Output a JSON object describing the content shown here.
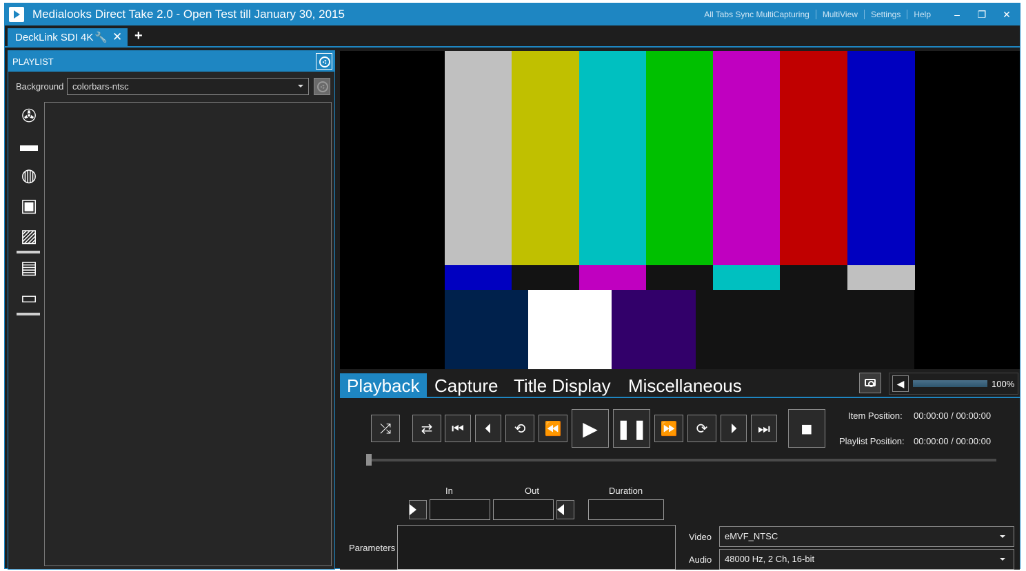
{
  "window": {
    "title": "Medialooks Direct Take 2.0 - Open Test till January 30, 2015",
    "menu": [
      "All Tabs Sync MultiCapturing",
      "MultiView",
      "Settings",
      "Help"
    ],
    "controls": {
      "minimize": "–",
      "maximize": "❐",
      "close": "✕"
    }
  },
  "tabbar": {
    "device_tab": "DeckLink SDI 4K",
    "pin_icon": "🔧",
    "close_glyph": "✕",
    "add_glyph": "+"
  },
  "playlist": {
    "title": "PLAYLIST",
    "background_label": "Background",
    "background_value": "colorbars-ntsc",
    "tools": [
      {
        "icon": "film-reel-icon",
        "glyph": "✇"
      },
      {
        "icon": "video-camera-icon",
        "glyph": "▬"
      },
      {
        "icon": "globe-icon",
        "glyph": "◍"
      },
      {
        "icon": "media-file-icon",
        "glyph": "▣"
      },
      {
        "icon": "image-icon",
        "glyph": "▨"
      },
      {
        "icon": "save-icon",
        "glyph": "▤"
      },
      {
        "icon": "open-folder-icon",
        "glyph": "▭"
      }
    ]
  },
  "preview": {
    "colors": {
      "gray": "#c0c0c0",
      "yellow": "#c0c000",
      "cyan": "#00c0c0",
      "green": "#00c000",
      "magenta": "#c000c0",
      "red": "#c00000",
      "blue": "#0000c0",
      "navy": "#00214c",
      "white": "#ffffff",
      "purple": "#32006a",
      "black": "#131313"
    }
  },
  "mainTabs": [
    "Playback",
    "Capture",
    "Title Display",
    "Miscellaneous"
  ],
  "volume": {
    "percent": "100%",
    "level": 1.0
  },
  "transport": [
    {
      "name": "shuffle-button",
      "glyph": "⤮"
    },
    {
      "name": "loop-button",
      "glyph": "⇄"
    },
    {
      "name": "first-button",
      "glyph": "⏮"
    },
    {
      "name": "prev-button",
      "glyph": "⏴"
    },
    {
      "name": "step-back-button",
      "glyph": "⟲"
    },
    {
      "name": "rewind-button",
      "glyph": "⏪"
    },
    {
      "name": "play-button",
      "glyph": "▶"
    },
    {
      "name": "pause-button",
      "glyph": "❚❚"
    },
    {
      "name": "forward-button",
      "glyph": "⏩"
    },
    {
      "name": "step-forward-button",
      "glyph": "⟳"
    },
    {
      "name": "next-button",
      "glyph": "⏵"
    },
    {
      "name": "last-button",
      "glyph": "⏭"
    },
    {
      "name": "stop-button",
      "glyph": "■"
    }
  ],
  "positions": {
    "item_label": "Item Position:",
    "item_value": "00:00:00 / 00:00:00",
    "playlist_label": "Playlist Position:",
    "playlist_value": "00:00:00 / 00:00:00"
  },
  "trim": {
    "in_label": "In",
    "out_label": "Out",
    "duration_label": "Duration"
  },
  "params": {
    "label": "Parameters",
    "video_label": "Video",
    "video_value": "eMVF_NTSC",
    "audio_label": "Audio",
    "audio_value": "48000 Hz, 2 Ch, 16-bit"
  }
}
